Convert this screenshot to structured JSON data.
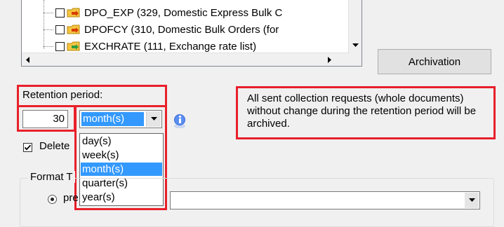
{
  "tree": {
    "items": [
      {
        "label": "DPO_EXP (329, Domestic Express Bulk C",
        "checked": false
      },
      {
        "label": "DPOFCY (310, Domestic Bulk Orders (for",
        "checked": false
      },
      {
        "label": "EXCHRATE (111, Exchange rate list)",
        "checked": false
      }
    ]
  },
  "archivation_button": "Archivation",
  "retention": {
    "label": "Retention period:",
    "value": "30",
    "unit_selected": "month(s)",
    "options": [
      "day(s)",
      "week(s)",
      "month(s)",
      "quarter(s)",
      "year(s)"
    ],
    "selected_index": 2
  },
  "delete_option": {
    "label": "Delete",
    "checked": true
  },
  "format_group": {
    "title": "Format T",
    "radio_label": "pre",
    "selected": true,
    "combo_value": ""
  },
  "note_text": "All sent collection requests (whole documents) without change during the retention period will be archived.",
  "colors": {
    "highlight": "#e8202a",
    "selection": "#3399ff"
  },
  "icons": {
    "info": "info-icon",
    "folder": "folder-icon"
  }
}
